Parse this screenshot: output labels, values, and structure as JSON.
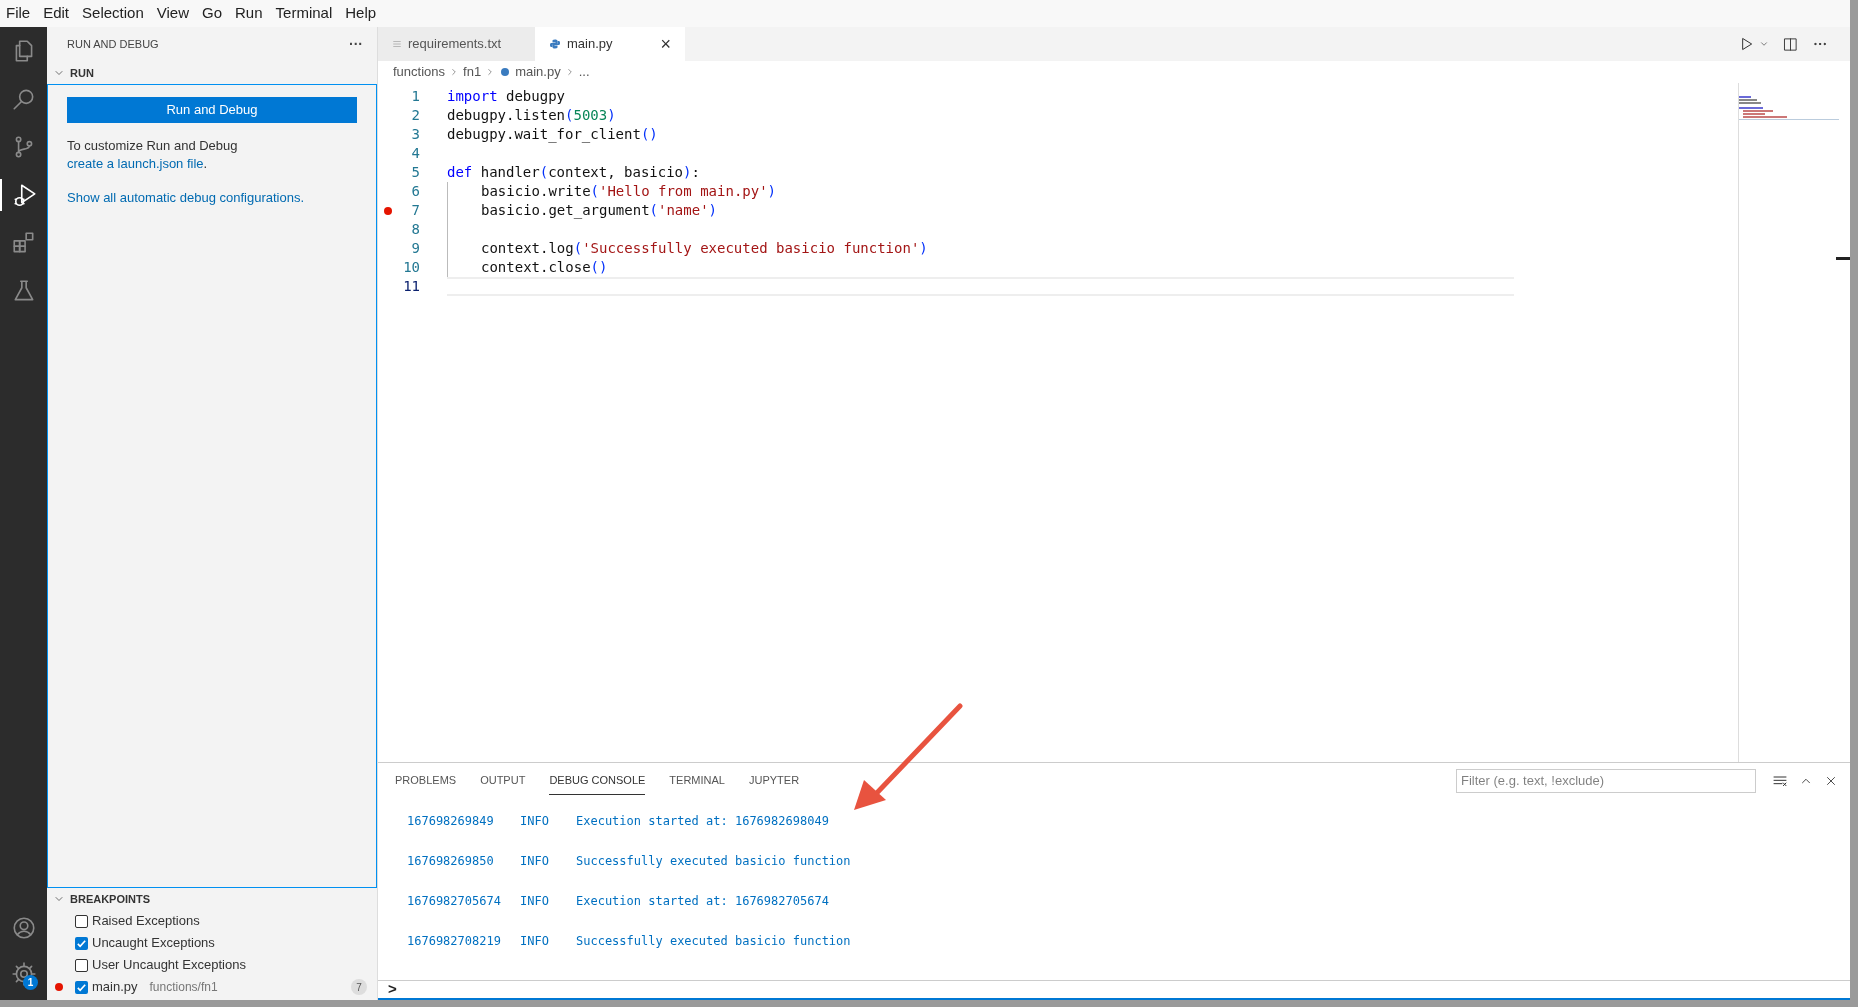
{
  "menu": [
    "File",
    "Edit",
    "Selection",
    "View",
    "Go",
    "Run",
    "Terminal",
    "Help"
  ],
  "activity_bar": {
    "top": [
      {
        "kind": "explorer",
        "selected": false
      },
      {
        "kind": "search",
        "selected": false
      },
      {
        "kind": "scm",
        "selected": false
      },
      {
        "kind": "debug",
        "selected": true
      },
      {
        "kind": "extensions",
        "selected": false
      },
      {
        "kind": "testing",
        "selected": false
      }
    ],
    "bottom": [
      {
        "kind": "account"
      },
      {
        "kind": "settings",
        "badge": "1"
      }
    ]
  },
  "sidebar": {
    "title": "RUN AND DEBUG",
    "more": "···",
    "run_section": {
      "header": "RUN",
      "expanded": true,
      "button": "Run and Debug",
      "text": "To customize Run and Debug",
      "link": "create a launch.json file",
      "text_end": ".",
      "link2": "Show all automatic debug configurations."
    },
    "breakpoints": {
      "header": "BREAKPOINTS",
      "expanded": true,
      "items": [
        {
          "kind": "exception",
          "label": "Raised Exceptions",
          "checked": false
        },
        {
          "kind": "exception",
          "label": "Uncaught Exceptions",
          "checked": true
        },
        {
          "kind": "exception",
          "label": "User Uncaught Exceptions",
          "checked": false
        },
        {
          "kind": "file",
          "label": "main.py",
          "path": "functions/fn1",
          "line": "7",
          "checked": true
        }
      ]
    }
  },
  "editor": {
    "tabs": [
      {
        "kind": "text",
        "label": "requirements.txt",
        "selected": false
      },
      {
        "kind": "python",
        "label": "main.py",
        "selected": true,
        "close": "×"
      }
    ],
    "breadcrumb": [
      "functions",
      "fn1",
      "main.py",
      "..."
    ],
    "lines": [
      {
        "number": "1",
        "tokens": [
          {
            "kind": "keyword",
            "t": "import"
          },
          {
            "kind": "plain",
            "t": " debugpy"
          }
        ]
      },
      {
        "number": "2",
        "tokens": [
          {
            "kind": "plain",
            "t": "debugpy.listen"
          },
          {
            "kind": "paren",
            "t": "("
          },
          {
            "kind": "number",
            "t": "5003"
          },
          {
            "kind": "paren",
            "t": ")"
          }
        ]
      },
      {
        "number": "3",
        "tokens": [
          {
            "kind": "plain",
            "t": "debugpy.wait_for_client"
          },
          {
            "kind": "paren",
            "t": "()"
          }
        ]
      },
      {
        "number": "4"
      },
      {
        "number": "5",
        "tokens": [
          {
            "kind": "keyword",
            "t": "def"
          },
          {
            "kind": "plain",
            "t": " handler"
          },
          {
            "kind": "paren",
            "t": "("
          },
          {
            "kind": "plain",
            "t": "context, basicio"
          },
          {
            "kind": "paren",
            "t": ")"
          },
          {
            "kind": "plain",
            "t": ":"
          }
        ]
      },
      {
        "number": "6",
        "indent": true,
        "tokens": [
          {
            "kind": "plain",
            "t": "basicio.write"
          },
          {
            "kind": "paren",
            "t": "("
          },
          {
            "kind": "string",
            "t": "'Hello from main.py'"
          },
          {
            "kind": "paren",
            "t": ")"
          }
        ]
      },
      {
        "number": "7",
        "indent": true,
        "breakpoint": true,
        "tokens": [
          {
            "kind": "plain",
            "t": "basicio.get_argument"
          },
          {
            "kind": "paren",
            "t": "("
          },
          {
            "kind": "string",
            "t": "'name'"
          },
          {
            "kind": "paren",
            "t": ")"
          }
        ]
      },
      {
        "number": "8",
        "indent": true
      },
      {
        "number": "9",
        "indent": true,
        "tokens": [
          {
            "kind": "plain",
            "t": "context.log"
          },
          {
            "kind": "paren",
            "t": "("
          },
          {
            "kind": "string",
            "t": "'Successfully executed basicio function'"
          },
          {
            "kind": "paren",
            "t": ")"
          }
        ]
      },
      {
        "number": "10",
        "indent": true,
        "tokens": [
          {
            "kind": "plain",
            "t": "context.close"
          },
          {
            "kind": "paren",
            "t": "()"
          }
        ]
      },
      {
        "number": "11",
        "current": true
      }
    ]
  },
  "panel": {
    "tabs": [
      {
        "label": "PROBLEMS",
        "selected": false
      },
      {
        "label": "OUTPUT",
        "selected": false
      },
      {
        "label": "DEBUG CONSOLE",
        "selected": true
      },
      {
        "label": "TERMINAL",
        "selected": false
      },
      {
        "label": "JUPYTER",
        "selected": false
      }
    ],
    "filter": {
      "placeholder": "Filter (e.g. text, !exclude)"
    },
    "console": [
      {
        "time": "167698269849",
        "level": "INFO",
        "message": "Execution started at: 1676982698049"
      },
      {
        "time": "167698269850",
        "level": "INFO",
        "message": "Successfully executed basicio function"
      },
      {
        "time": "1676982705674",
        "level": "INFO",
        "message": "Execution started at: 1676982705674"
      },
      {
        "time": "1676982708219",
        "level": "INFO",
        "message": "Successfully executed basicio function"
      }
    ],
    "prompt": ">"
  }
}
